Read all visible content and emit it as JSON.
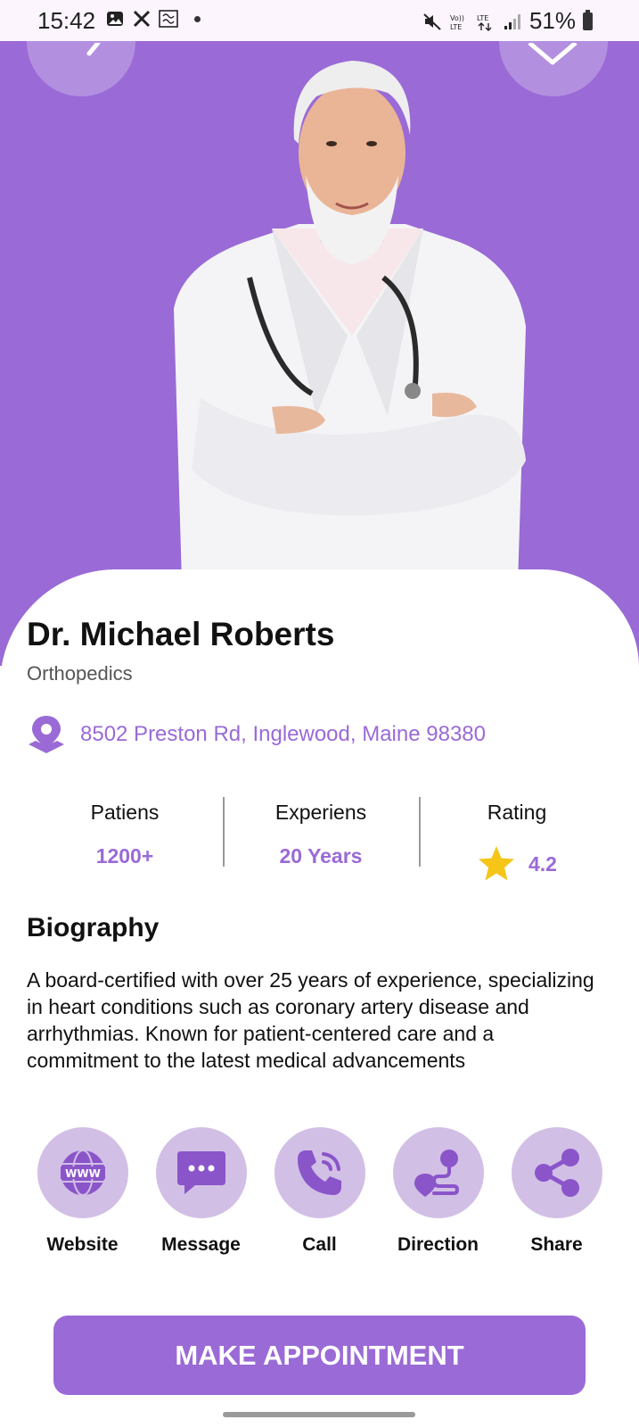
{
  "status_bar": {
    "time": "15:42",
    "battery": "51%",
    "icons": [
      "gallery-icon",
      "x-app-icon",
      "notification-icon",
      "dot-icon",
      "mute-icon",
      "volte-icon",
      "lte-icon",
      "signal-icon",
      "battery-icon"
    ]
  },
  "doctor": {
    "name": "Dr. Michael Roberts",
    "specialty": "Orthopedics",
    "address": "8502 Preston Rd, Inglewood, Maine 98380"
  },
  "stats": [
    {
      "label": "Patiens",
      "value": "1200+"
    },
    {
      "label": "Experiens",
      "value": "20 Years"
    },
    {
      "label": "Rating",
      "value": "4.2"
    }
  ],
  "biography": {
    "title": "Biography",
    "text": "A board-certified with over 25 years of experience, specializing in heart conditions such as coronary artery disease and arrhythmias. Known for patient-centered care  and a commitment to the latest medical advancements"
  },
  "actions": [
    {
      "label": "Website",
      "icon": "www-globe-icon"
    },
    {
      "label": "Message",
      "icon": "message-icon"
    },
    {
      "label": "Call",
      "icon": "phone-icon"
    },
    {
      "label": "Direction",
      "icon": "direction-icon"
    },
    {
      "label": "Share",
      "icon": "share-icon"
    }
  ],
  "cta": {
    "label": "MAKE APPOINTMENT"
  },
  "colors": {
    "accent": "#9a6ad6",
    "accent_light": "#d2bfe6",
    "star": "#f5c518",
    "status_bar_bg": "#fcf5fe"
  }
}
